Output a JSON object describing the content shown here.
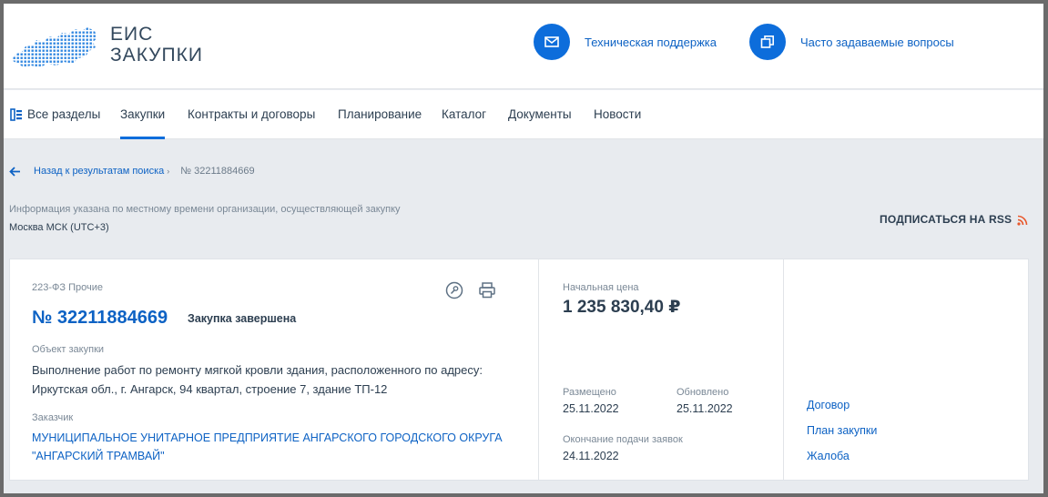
{
  "header": {
    "logo_line1": "ЕИС",
    "logo_line2": "ЗАКУПКИ",
    "support_label": "Техническая поддержка",
    "faq_label": "Часто задаваемые вопросы",
    "accent_color": "#0d6ddb"
  },
  "nav": {
    "items": [
      {
        "label": "Все разделы",
        "icon": "sections-icon"
      },
      {
        "label": "Закупки",
        "active": true
      },
      {
        "label": "Контракты и договоры"
      },
      {
        "label": "Планирование"
      },
      {
        "label": "Каталог"
      },
      {
        "label": "Документы"
      },
      {
        "label": "Новости"
      }
    ]
  },
  "breadcrumb": {
    "back_label": "Назад к результатам поиска",
    "separator": "›",
    "current": "№ 32211884669"
  },
  "info_note": "Информация указана по местному времени организации, осуществляющей закупку",
  "timezone": "Москва МСК (UTC+3)",
  "rss_label": "ПОДПИСАТЬСЯ НА RSS",
  "card": {
    "law": "223-ФЗ Прочие",
    "number": "№ 32211884669",
    "status": "Закупка завершена",
    "object_label": "Объект закупки",
    "object_text": "Выполнение работ по ремонту мягкой кровли здания, расположенного по адресу: Иркутская обл., г. Ангарск, 94 квартал, строение 7, здание ТП-12",
    "customer_label": "Заказчик",
    "customer_text": "МУНИЦИПАЛЬНОЕ УНИТАРНОЕ ПРЕДПРИЯТИЕ АНГАРСКОГО ГОРОДСКОГО ОКРУГА \"АНГАРСКИЙ ТРАМВАЙ\"",
    "price_label": "Начальная цена",
    "price": "1 235 830,40 ₽",
    "posted_label": "Размещено",
    "posted": "25.11.2022",
    "updated_label": "Обновлено",
    "updated": "25.11.2022",
    "deadline_label": "Окончание подачи заявок",
    "deadline": "24.11.2022",
    "links": [
      "Договор",
      "План закупки",
      "Жалоба"
    ]
  }
}
